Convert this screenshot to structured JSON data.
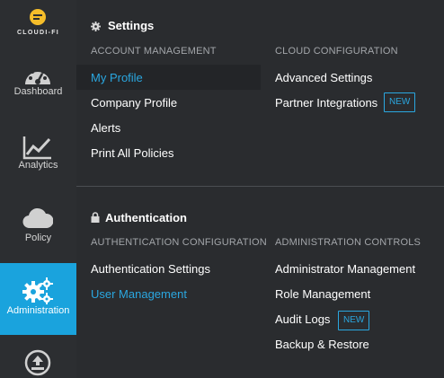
{
  "brand": {
    "name": "CLOUDI-FI"
  },
  "sidebar": {
    "items": [
      {
        "label": "Dashboard",
        "icon": "speedometer-icon"
      },
      {
        "label": "Analytics",
        "icon": "chart-line-icon"
      },
      {
        "label": "Policy",
        "icon": "cloud-icon"
      },
      {
        "label": "Administration",
        "icon": "gears-icon",
        "active": true
      },
      {
        "label": "",
        "icon": "upload-icon"
      }
    ]
  },
  "settings": {
    "title": "Settings",
    "account_management": {
      "header": "ACCOUNT MANAGEMENT",
      "links": [
        "My Profile",
        "Company Profile",
        "Alerts",
        "Print All Policies"
      ]
    },
    "cloud_configuration": {
      "header": "CLOUD CONFIGURATION",
      "links": [
        "Advanced Settings",
        "Partner Integrations"
      ],
      "badge": "NEW"
    }
  },
  "authentication": {
    "title": "Authentication",
    "authentication_configuration": {
      "header": "AUTHENTICATION CONFIGURATION",
      "links": [
        "Authentication Settings",
        "User Management"
      ]
    },
    "administration_controls": {
      "header": "ADMINISTRATION CONTROLS",
      "links": [
        "Administrator Management",
        "Role Management",
        "Audit Logs",
        "Backup & Restore"
      ],
      "badge": "NEW"
    }
  },
  "colors": {
    "accent": "#1aa3dd",
    "logo": "#f5bd2a",
    "background": "#2a2c2f"
  }
}
